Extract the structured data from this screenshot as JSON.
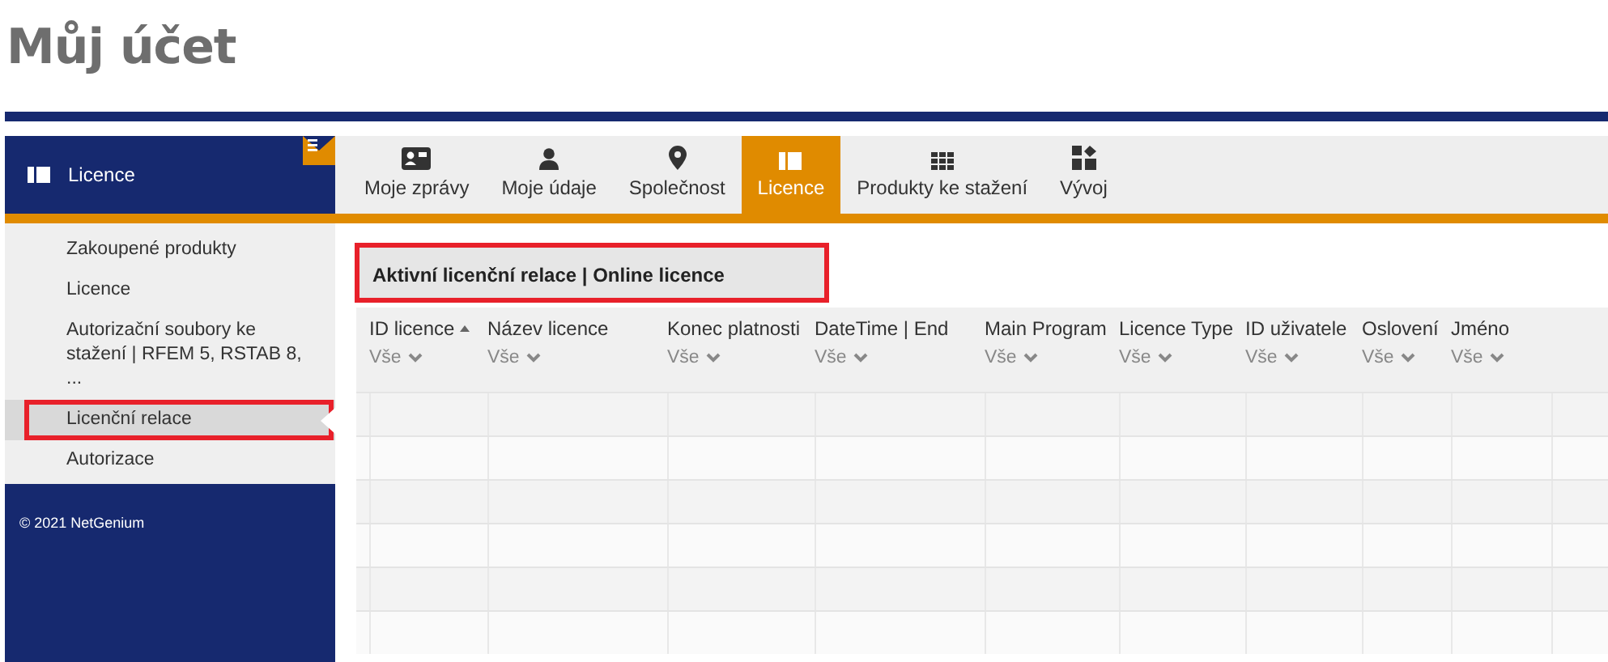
{
  "page_title": "Můj účet",
  "sidebar": {
    "header": "Licence",
    "items": [
      {
        "label": "Zakoupené produkty",
        "selected": false,
        "highlighted": false
      },
      {
        "label": "Licence",
        "selected": false,
        "highlighted": false
      },
      {
        "label": "Autorizační soubory ke stažení | RFEM 5, RSTAB 8, ...",
        "selected": false,
        "highlighted": false
      },
      {
        "label": "Licenční relace",
        "selected": true,
        "highlighted": true
      },
      {
        "label": "Autorizace",
        "selected": false,
        "highlighted": false
      }
    ],
    "footer": "© 2021 NetGenium"
  },
  "tabs": [
    {
      "label": "Moje zprávy",
      "selected": false
    },
    {
      "label": "Moje údaje",
      "selected": false
    },
    {
      "label": "Společnost",
      "selected": false
    },
    {
      "label": "Licence",
      "selected": true
    },
    {
      "label": "Produkty ke stažení",
      "selected": false
    },
    {
      "label": "Vývoj",
      "selected": false
    }
  ],
  "panel": {
    "title": "Aktivní licenční relace | Online licence",
    "highlighted": true
  },
  "table": {
    "columns": [
      {
        "label": "ID licence",
        "filter": "Vše",
        "sorted": true
      },
      {
        "label": "Název licence",
        "filter": "Vše",
        "sorted": false
      },
      {
        "label": "Konec platnosti",
        "filter": "Vše",
        "sorted": false
      },
      {
        "label": "DateTime | End",
        "filter": "Vše",
        "sorted": false
      },
      {
        "label": "Main Program",
        "filter": "Vše",
        "sorted": false
      },
      {
        "label": "Licence Type",
        "filter": "Vše",
        "sorted": false
      },
      {
        "label": "ID uživatele",
        "filter": "Vše",
        "sorted": false
      },
      {
        "label": "Oslovení",
        "filter": "Vše",
        "sorted": false
      },
      {
        "label": "Jméno",
        "filter": "Vše",
        "sorted": false
      }
    ]
  }
}
